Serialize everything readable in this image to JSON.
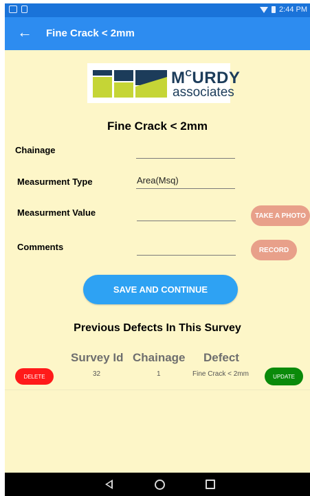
{
  "statusbar": {
    "time": "2:44 PM"
  },
  "appbar": {
    "back_icon": "arrow-left-icon",
    "title": "Fine Crack < 2mm"
  },
  "logo": {
    "brand_main": "McCURDY",
    "brand_sup": "C",
    "brand_first": "M",
    "brand_rest": "URDY",
    "brand_sub": "associates"
  },
  "form": {
    "title": "Fine Crack < 2mm",
    "chainage_label": "Chainage",
    "chainage_value": "",
    "measurement_type_label": "Measurment Type",
    "measurement_type_value": "Area(Msq)",
    "measurement_value_label": "Measurment Value",
    "measurement_value_value": "",
    "comments_label": "Comments",
    "comments_value": "",
    "take_photo_label": "TAKE A PHOTO",
    "record_label": "RECORD",
    "save_label": "SAVE AND CONTINUE"
  },
  "previous": {
    "title": "Previous Defects In This Survey",
    "headers": [
      "Survey Id",
      "Chainage",
      "Defect"
    ],
    "rows": [
      {
        "survey_id": "32",
        "chainage": "1",
        "defect": "Fine Crack < 2mm",
        "delete_label": "DELETE",
        "update_label": "UPDATE"
      }
    ]
  },
  "colors": {
    "appbar": "#2d8cf0",
    "statusbar": "#1a73d9",
    "background": "#fdf6c8",
    "save_button": "#2ea2f3",
    "photo_button": "#e8a08a",
    "delete_button": "#ff1a1a",
    "update_button": "#0a8a0a"
  },
  "navbar": {
    "back_icon": "nav-back-icon",
    "home_icon": "nav-home-icon",
    "recent_icon": "nav-recent-icon"
  }
}
